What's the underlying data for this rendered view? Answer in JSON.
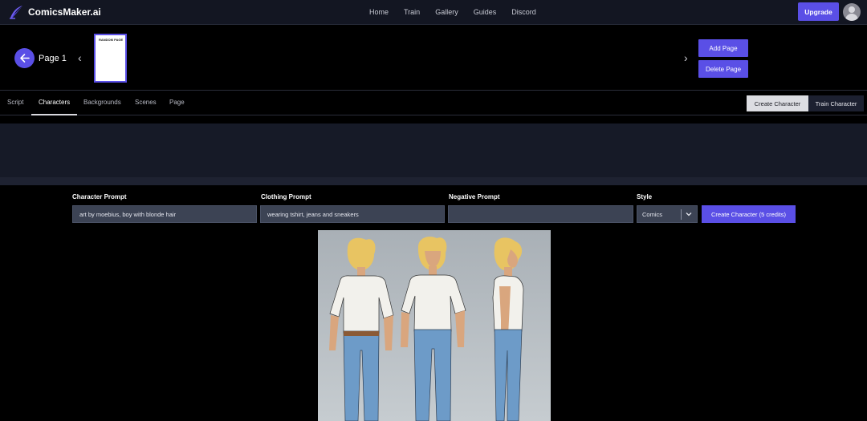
{
  "app": {
    "brand": "ComicsMaker.ai"
  },
  "nav": {
    "links": [
      "Home",
      "Train",
      "Gallery",
      "Guides",
      "Discord"
    ],
    "upgrade": "Upgrade"
  },
  "page": {
    "label": "Page 1",
    "thumb_text": "RANDOM PAGE",
    "add": "Add Page",
    "delete": "Delete Page"
  },
  "tabs": [
    "Script",
    "Characters",
    "Backgrounds",
    "Scenes",
    "Page"
  ],
  "active_tab": "Characters",
  "toggle": {
    "create": "Create Character",
    "train": "Train Character"
  },
  "form": {
    "character_label": "Character Prompt",
    "character_value": "art by moebius, boy with blonde hair",
    "clothing_label": "Clothing Prompt",
    "clothing_value": "wearing tshirt, jeans and sneakers",
    "negative_label": "Negative Prompt",
    "negative_value": "",
    "style_label": "Style",
    "style_value": "Comics",
    "create_button": "Create Character (5 credits)"
  },
  "colors": {
    "accent": "#5a4fe6",
    "nav_bg": "#131622",
    "panel_bg": "#161a27",
    "input_bg": "#3c4354"
  },
  "icons": [
    "quill-logo-icon",
    "arrow-left-icon",
    "chevron-left-icon",
    "chevron-right-icon",
    "chevron-down-icon",
    "user-avatar-icon"
  ]
}
